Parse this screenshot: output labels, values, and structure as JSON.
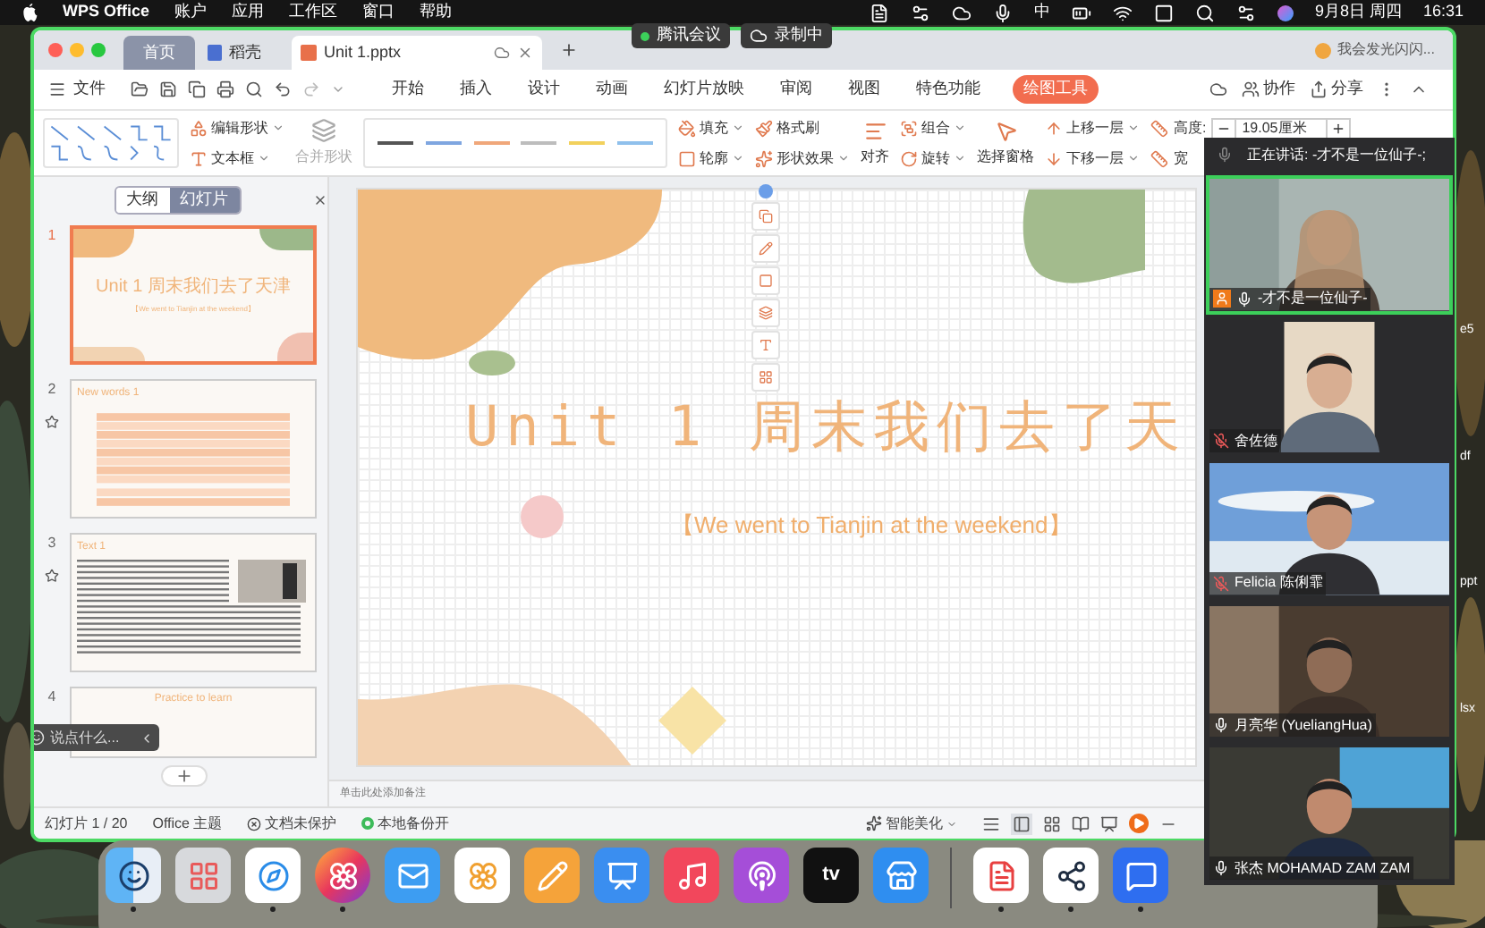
{
  "menubar": {
    "app": "WPS Office",
    "menus": [
      "账户",
      "应用",
      "工作区",
      "窗口",
      "帮助"
    ],
    "input_method": "中",
    "date": "9月8日 周四",
    "time": "16:31"
  },
  "meeting_bar": {
    "app": "腾讯会议",
    "recording": "录制中"
  },
  "window": {
    "tabs": [
      {
        "label": "首页",
        "kind": "home",
        "selected": false
      },
      {
        "label": "稻壳",
        "kind": "docer",
        "selected": false
      },
      {
        "label": "Unit 1.pptx",
        "kind": "file",
        "selected": true
      }
    ],
    "user": "我会发光闪闪..."
  },
  "menu": {
    "file": "文件",
    "items": [
      {
        "label": "开始",
        "selected": false
      },
      {
        "label": "插入",
        "selected": false
      },
      {
        "label": "设计",
        "selected": false
      },
      {
        "label": "动画",
        "selected": false
      },
      {
        "label": "幻灯片放映",
        "selected": false
      },
      {
        "label": "审阅",
        "selected": false
      },
      {
        "label": "视图",
        "selected": false
      },
      {
        "label": "特色功能",
        "selected": false
      },
      {
        "label": "绘图工具",
        "selected": true
      }
    ],
    "collab": "协作",
    "share": "分享"
  },
  "ribbon": {
    "edit_shape": "编辑形状",
    "text_box": "文本框",
    "merge_shape": {
      "label": "合并形状",
      "disabled": true
    },
    "line_styles": [
      {
        "color": "#555555"
      },
      {
        "color": "#7fa6e0"
      },
      {
        "color": "#f0a77a"
      },
      {
        "color": "#bdbdbd"
      },
      {
        "color": "#f2d15c"
      },
      {
        "color": "#8fc0ec"
      }
    ],
    "fill": "填充",
    "format_painter": "格式刷",
    "outline": "轮廓",
    "shape_effects": "形状效果",
    "align": "对齐",
    "group": "组合",
    "rotate": "旋转",
    "selection_pane": "选择窗格",
    "bring_forward": "上移一层",
    "send_backward": "下移一层",
    "height_label": "高度:",
    "height_value": "19.05厘米",
    "width_label": "宽"
  },
  "slides_panel": {
    "tabs": [
      {
        "label": "大纲",
        "selected": false
      },
      {
        "label": "幻灯片",
        "selected": true
      }
    ],
    "slides": [
      {
        "number": "1",
        "kind": "title",
        "selected": true,
        "starred": false,
        "title": "Unit 1 周末我们去了天津",
        "subtitle": "【We went to Tianjin at the weekend】"
      },
      {
        "number": "2",
        "kind": "table",
        "selected": false,
        "starred": true,
        "title": "New words 1"
      },
      {
        "number": "3",
        "kind": "text",
        "selected": false,
        "starred": true,
        "title": "Text 1"
      },
      {
        "number": "4",
        "kind": "practice",
        "selected": false,
        "starred": false,
        "title": "Practice to learn"
      }
    ]
  },
  "chat": {
    "placeholder": "说点什么..."
  },
  "slide": {
    "title": "Unit 1 周末我们去了天",
    "subtitle": "【We went to Tianjin at the weekend】"
  },
  "notes": {
    "placeholder": "单击此处添加备注"
  },
  "status_bar": {
    "slide_count": "幻灯片 1 / 20",
    "theme": "Office 主题",
    "protection": "文档未保护",
    "backup": "本地备份开",
    "beautify": "智能美化"
  },
  "meeting_panel": {
    "speaking": "正在讲话: -才不是一位仙子-;",
    "participants": [
      {
        "name": "-才不是一位仙子-",
        "muted": false,
        "speaking": true,
        "host": true
      },
      {
        "name": "舍佐德",
        "muted": true,
        "speaking": false,
        "host": false
      },
      {
        "name": "Felicia 陈俐霏",
        "muted": true,
        "speaking": false,
        "host": false
      },
      {
        "name": "月亮华 (YueliangHua)",
        "muted": false,
        "speaking": false,
        "host": false
      },
      {
        "name": "张杰 MOHAMAD ZAM ZAM",
        "muted": false,
        "speaking": false,
        "host": false
      }
    ]
  },
  "desktop_files": [
    "e5",
    "df",
    "ppt",
    "lsx"
  ],
  "dock": [
    {
      "kind": "finder",
      "running": true
    },
    {
      "kind": "launchpad",
      "running": false
    },
    {
      "kind": "safari",
      "running": true
    },
    {
      "kind": "firefox",
      "running": true
    },
    {
      "kind": "mail",
      "running": false
    },
    {
      "kind": "photos",
      "running": false
    },
    {
      "kind": "pages",
      "running": false
    },
    {
      "kind": "keynote",
      "running": false
    },
    {
      "kind": "music",
      "running": false
    },
    {
      "kind": "podcasts",
      "running": false
    },
    {
      "kind": "tv",
      "label": "tv",
      "running": false
    },
    {
      "kind": "appstore",
      "running": false
    },
    {
      "kind": "wps",
      "running": true
    },
    {
      "kind": "share",
      "running": true
    },
    {
      "kind": "lark",
      "running": true
    }
  ]
}
